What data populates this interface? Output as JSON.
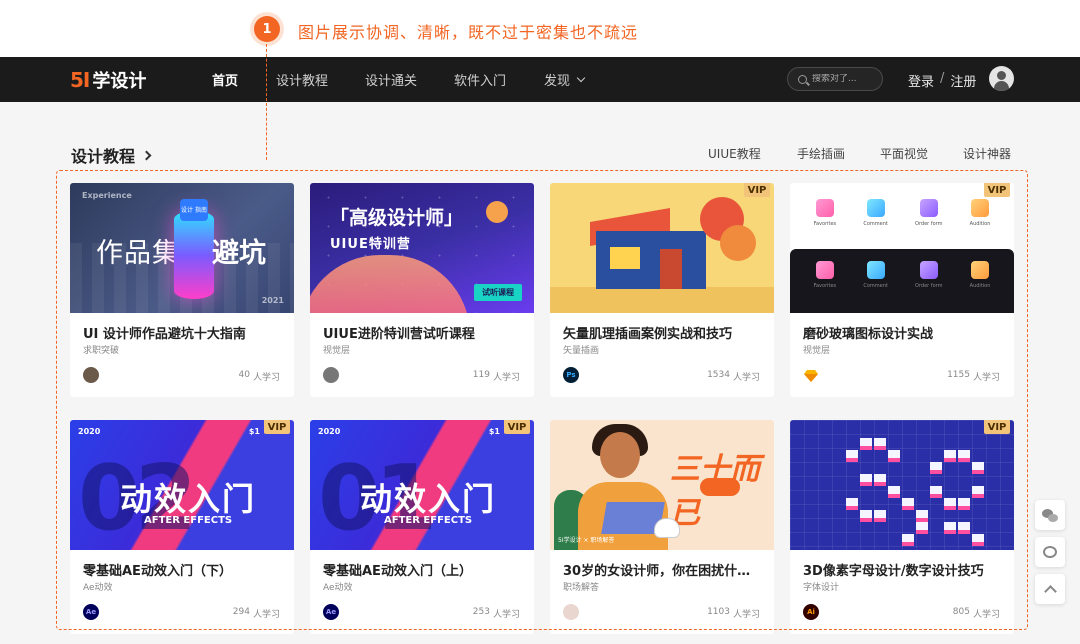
{
  "annotation": {
    "number": "1",
    "text": "图片展示协调、清晰，既不过于密集也不疏远",
    "color": "#f26522"
  },
  "nav": {
    "logo_num": "5I",
    "logo_text": "学设计",
    "items": [
      "首页",
      "设计教程",
      "设计通关",
      "软件入门",
      "发现"
    ],
    "active": "首页",
    "search_placeholder": "搜索对了...",
    "login": "登录",
    "separator": "/",
    "register": "注册"
  },
  "section": {
    "title": "设计教程",
    "links": [
      "UIUE教程",
      "手绘插画",
      "平面视觉",
      "设计神器"
    ]
  },
  "cards": [
    {
      "title": "UI 设计师作品避坑十大指南",
      "category": "求职突破",
      "learners": "40",
      "unit": "人学习",
      "vip": false,
      "thumb": {
        "tag": "Experience",
        "cyl_tag": "设计 指南",
        "big_left": "作品集",
        "big_right": "避坑",
        "year": "2021"
      }
    },
    {
      "title": "UIUE进阶特训营试听课程",
      "category": "视觉层",
      "learners": "119",
      "unit": "人学习",
      "vip": false,
      "thumb": {
        "t1": "「高级设计师」",
        "t2": "UIUE特训营",
        "btn": "试听课程"
      }
    },
    {
      "title": "矢量肌理插画案例实战和技巧",
      "category": "矢量插画",
      "learners": "1534",
      "unit": "人学习",
      "vip": true,
      "avatar": "Ps"
    },
    {
      "title": "磨砂玻璃图标设计实战",
      "category": "视觉层",
      "learners": "1155",
      "unit": "人学习",
      "vip": true,
      "thumb": {
        "labels": [
          "Favorites",
          "Comment",
          "Order form",
          "Audition"
        ]
      }
    },
    {
      "title": "零基础AE动效入门（下）",
      "category": "Ae动效",
      "learners": "294",
      "unit": "人学习",
      "vip": true,
      "avatar": "Ae",
      "thumb": {
        "year": "2020",
        "price": "$1",
        "ghost": "02",
        "big": "动效入门",
        "sub": "AFTER EFFECTS"
      }
    },
    {
      "title": "零基础AE动效入门（上）",
      "category": "Ae动效",
      "learners": "253",
      "unit": "人学习",
      "vip": true,
      "avatar": "Ae",
      "thumb": {
        "year": "2020",
        "price": "$1",
        "ghost": "01",
        "big": "动效入门",
        "sub": "AFTER EFFECTS"
      }
    },
    {
      "title": "30岁的女设计师，你在困扰什…",
      "category": "职场解答",
      "learners": "1103",
      "unit": "人学习",
      "vip": false,
      "thumb": {
        "calli": "三十而已",
        "caption": "5I学设计 × 职场解答"
      }
    },
    {
      "title": "3D像素字母设计/数字设计技巧",
      "category": "字体设计",
      "learners": "805",
      "unit": "人学习",
      "vip": true,
      "avatar": "Ai"
    }
  ],
  "vip_label": "VIP",
  "icons": {
    "side": [
      "wechat-icon",
      "weibo-icon",
      "back-to-top-icon"
    ]
  }
}
